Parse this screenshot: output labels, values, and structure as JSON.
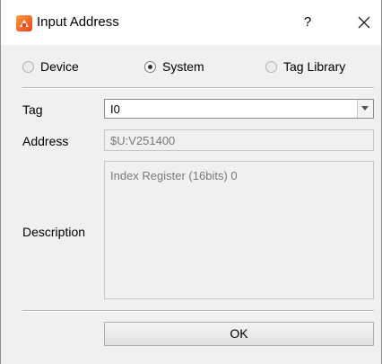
{
  "window": {
    "title": "Input Address",
    "help_label": "?",
    "icon": "app-logo-icon",
    "close_icon": "close-icon"
  },
  "source_options": [
    {
      "label": "Device",
      "checked": false
    },
    {
      "label": "System",
      "checked": true
    },
    {
      "label": "Tag Library",
      "checked": false
    }
  ],
  "fields": {
    "tag_label": "Tag",
    "tag_value": "I0",
    "address_label": "Address",
    "address_value": "$U:V251400",
    "description_label": "Description",
    "description_value": "Index Register (16bits) 0"
  },
  "buttons": {
    "ok_label": "OK"
  },
  "colors": {
    "dialog_bg": "#f0f0f0",
    "titlebar_bg": "#ffffff",
    "icon_accent": "#e8441d"
  }
}
